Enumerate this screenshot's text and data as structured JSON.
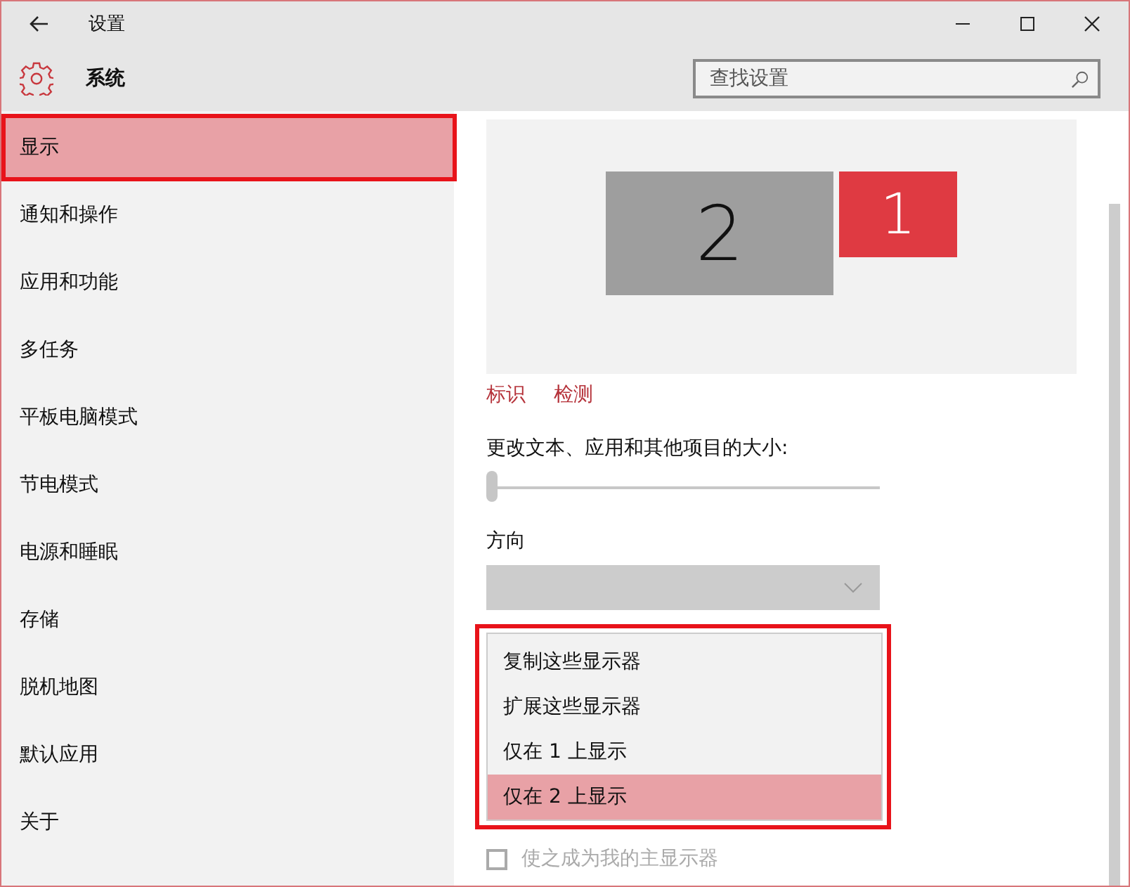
{
  "window": {
    "title": "设置"
  },
  "header": {
    "title": "系统"
  },
  "search": {
    "placeholder": "查找设置"
  },
  "sidebar": {
    "items": [
      {
        "label": "显示",
        "selected": true,
        "highlighted": true
      },
      {
        "label": "通知和操作",
        "selected": false,
        "highlighted": false
      },
      {
        "label": "应用和功能",
        "selected": false,
        "highlighted": false
      },
      {
        "label": "多任务",
        "selected": false,
        "highlighted": false
      },
      {
        "label": "平板电脑模式",
        "selected": false,
        "highlighted": false
      },
      {
        "label": "节电模式",
        "selected": false,
        "highlighted": false
      },
      {
        "label": "电源和睡眠",
        "selected": false,
        "highlighted": false
      },
      {
        "label": "存储",
        "selected": false,
        "highlighted": false
      },
      {
        "label": "脱机地图",
        "selected": false,
        "highlighted": false
      },
      {
        "label": "默认应用",
        "selected": false,
        "highlighted": false
      },
      {
        "label": "关于",
        "selected": false,
        "highlighted": false
      }
    ]
  },
  "displays": [
    {
      "label": "2",
      "selected": false
    },
    {
      "label": "1",
      "selected": true
    }
  ],
  "display_links": [
    "标识",
    "检测"
  ],
  "scale": {
    "label": "更改文本、应用和其他项目的大小:",
    "level": 0
  },
  "orientation": {
    "label": "方向",
    "disabled": true
  },
  "multiple_displays_menu": {
    "highlighted": true,
    "options": [
      {
        "label": "复制这些显示器",
        "selected": false
      },
      {
        "label": "扩展这些显示器",
        "selected": false
      },
      {
        "label": "仅在 1 上显示",
        "selected": false
      },
      {
        "label": "仅在 2 上显示",
        "selected": true
      }
    ]
  },
  "main_display_checkbox": {
    "label": "使之成为我的主显示器",
    "checked": false,
    "disabled": true
  }
}
